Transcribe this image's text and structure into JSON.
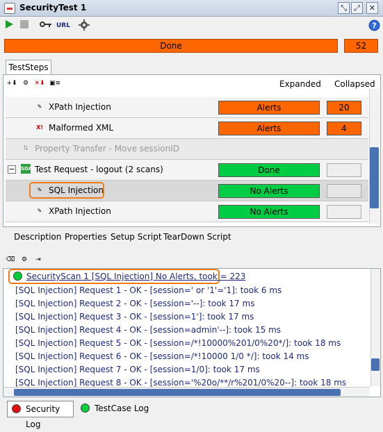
{
  "window": {
    "title": "SecurityTest 1"
  },
  "progress": {
    "label": "Done",
    "count": "52",
    "fraction": 1.0,
    "color": "#ff6600"
  },
  "tabs": {
    "teststeps": "TestSteps"
  },
  "columns": {
    "expanded": "Expanded",
    "collapsed": "Collapsed"
  },
  "toolbar": {
    "url_label": "URL"
  },
  "rows": [
    {
      "label": "XPath Injection",
      "status": "Alerts",
      "count": "20",
      "status_color": "#ff6600"
    },
    {
      "label": "Malformed XML",
      "status": "Alerts",
      "count": "4",
      "status_color": "#ff6600"
    },
    {
      "label": "Property Transfer - Move sessionID"
    },
    {
      "label": "Test Request - logout (2 scans)",
      "status": "Done",
      "status_color": "#00cc44"
    },
    {
      "label": "SQL Injection",
      "status": "No Alerts",
      "status_color": "#00cc44"
    },
    {
      "label": "XPath Injection",
      "status": "No Alerts",
      "status_color": "#00cc44"
    }
  ],
  "subtabs": [
    "Description",
    "Properties",
    "Setup Script",
    "TearDown Script"
  ],
  "log": {
    "header": "SecurityScan 1 [SQL Injection] No Alerts, took = 223",
    "lines": [
      "[SQL Injection] Request 1 - OK - [session=' or '1'='1]: took 6 ms",
      "[SQL Injection] Request 2 - OK - [session='--]: took 17 ms",
      "[SQL Injection] Request 3 - OK - [session=1']: took 17 ms",
      "[SQL Injection] Request 4 - OK - [session=admin'--]: took 15 ms",
      "[SQL Injection] Request 5 - OK - [session=/*!10000%201/0%20*/]: took 18 ms",
      "[SQL Injection] Request 6 - OK - [session=/*!10000 1/0 */]: took 14 ms",
      "[SQL Injection] Request 7 - OK - [session=1/0]: took 17 ms",
      "[SQL Injection] Request 8 - OK - [session='%20o/**/r%201/0%20--]: took 18 ms"
    ]
  },
  "bottom_tabs": {
    "security_log": "Security Log",
    "testcase_log": "TestCase Log"
  }
}
